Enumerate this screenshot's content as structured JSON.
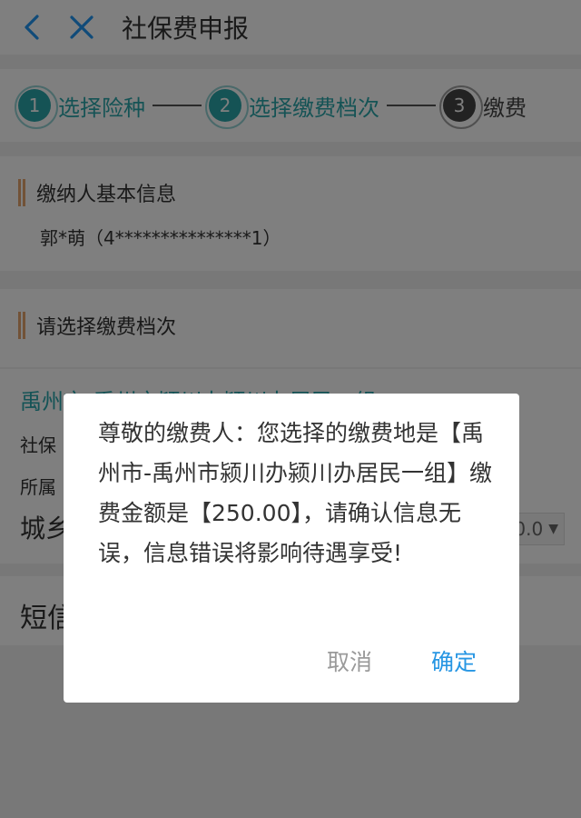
{
  "header": {
    "title": "社保费申报",
    "back_icon": "chevron-left-icon",
    "close_icon": "close-icon",
    "icon_color": "#2196f3"
  },
  "steps": [
    {
      "num": "1",
      "label": "选择险种",
      "color": "#2aa7ab"
    },
    {
      "num": "2",
      "label": "选择缴费档次",
      "color": "#2aa7ab"
    },
    {
      "num": "3",
      "label": "缴费",
      "color": "#444444"
    }
  ],
  "payer": {
    "section_title": "缴纳人基本信息",
    "info": "郭*萌（4***************1）"
  },
  "grade": {
    "section_title": "请选择缴费档次",
    "area": "禹州市-禹州市颍川办颍川办居民一组",
    "row1_label": "社保",
    "row2_label": "所属",
    "city_rural_label": "城乡",
    "amount_visible": "0.0"
  },
  "sms": {
    "label": "短信"
  },
  "dialog": {
    "message": "尊敬的缴费人：您选择的缴费地是【禹州市-禹州市颍川办颍川办居民一组】缴费金额是【250.00】，请确认信息无误，信息错误将影响待遇享受!",
    "cancel_label": "取消",
    "confirm_label": "确定"
  }
}
